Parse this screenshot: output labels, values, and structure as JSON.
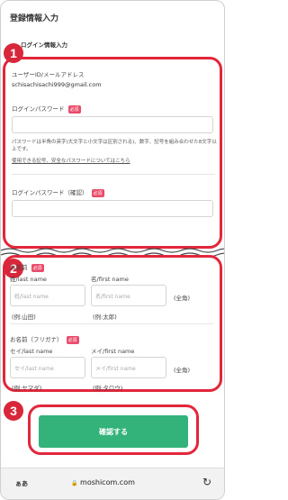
{
  "page": {
    "title": "登録情報入力",
    "section_title": "ログイン情報入力"
  },
  "markers": [
    "1",
    "2",
    "3"
  ],
  "login": {
    "user_label": "ユーザーID/メールアドレス",
    "user_value": "schisachisachi999@gmail.com",
    "password_label": "ログインパスワード",
    "required": "必須",
    "password_note": "パスワードは半角の英字(大文字と小文字は区別される)、数字、記号を組み合わせた8文字以上です。",
    "password_link": "使用できる記号、安全なパスワードについてはこちら",
    "password_confirm_label": "ログインパスワード（確認）"
  },
  "name": {
    "label": "お名前",
    "last_label": "姓/last name",
    "first_label": "名/first name",
    "last_placeholder": "姓/last name",
    "first_placeholder": "名/first name",
    "width_note": "(全角)",
    "last_example": "(例:山田)",
    "first_example": "(例:太郎)"
  },
  "kana": {
    "label": "お名前（フリガナ）",
    "last_label": "セイ/last name",
    "first_label": "メイ/first name",
    "last_placeholder": "セイ/last name",
    "first_placeholder": "メイ/first name",
    "width_note": "(全角)",
    "last_example": "(例:ヤマダ)",
    "first_example": "(例:タロウ)"
  },
  "confirm_button": "確認する",
  "browser": {
    "aa": "ぁあ",
    "url": "moshicom.com",
    "lock": "🔒",
    "reload": "↻"
  }
}
